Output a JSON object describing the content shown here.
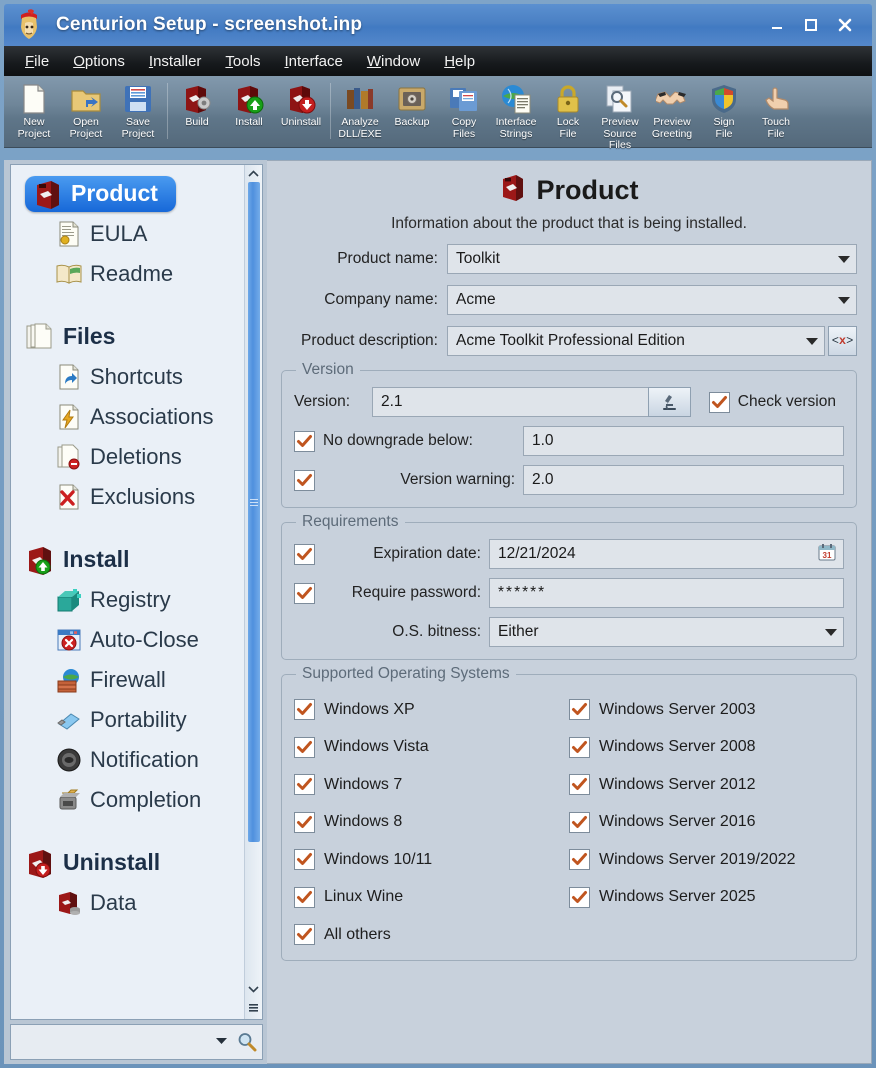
{
  "window": {
    "title": "Centurion Setup - screenshot.inp",
    "app_icon": "centurion-helmet-icon",
    "minimize_label": "_",
    "maximize_label": "□",
    "close_label": "✕"
  },
  "menubar": {
    "items": [
      {
        "name": "file",
        "label": "File",
        "mnemonic": "F"
      },
      {
        "name": "options",
        "label": "Options",
        "mnemonic": "O"
      },
      {
        "name": "installer",
        "label": "Installer",
        "mnemonic": "I"
      },
      {
        "name": "tools",
        "label": "Tools",
        "mnemonic": "T"
      },
      {
        "name": "interface",
        "label": "Interface",
        "mnemonic": "I"
      },
      {
        "name": "window",
        "label": "Window",
        "mnemonic": "W"
      },
      {
        "name": "help",
        "label": "Help",
        "mnemonic": "H"
      }
    ]
  },
  "toolbar": {
    "buttons": [
      {
        "name": "new-project",
        "line1": "New",
        "line2": "Project",
        "icon": "new-document-icon"
      },
      {
        "name": "open-project",
        "line1": "Open",
        "line2": "Project",
        "icon": "open-folder-icon"
      },
      {
        "name": "save-project",
        "line1": "Save",
        "line2": "Project",
        "icon": "floppy-disk-icon"
      },
      {
        "sep": true
      },
      {
        "name": "build",
        "line1": "Build",
        "line2": "",
        "icon": "box-gear-icon"
      },
      {
        "name": "install",
        "line1": "Install",
        "line2": "",
        "icon": "box-green-arrow-up-icon"
      },
      {
        "name": "uninstall",
        "line1": "Uninstall",
        "line2": "",
        "icon": "box-red-arrow-down-icon"
      },
      {
        "sep": true
      },
      {
        "name": "analyze-dll-exe",
        "line1": "Analyze",
        "line2": "DLL/EXE",
        "icon": "books-icon"
      },
      {
        "name": "backup",
        "line1": "Backup",
        "line2": "",
        "icon": "safe-icon"
      },
      {
        "name": "copy-files",
        "line1": "Copy",
        "line2": "Files",
        "icon": "copy-files-icon"
      },
      {
        "name": "interface-strings",
        "line1": "Interface",
        "line2": "Strings",
        "icon": "globe-document-icon"
      },
      {
        "name": "lock-file",
        "line1": "Lock",
        "line2": "File",
        "icon": "padlock-icon"
      },
      {
        "name": "preview-source-files",
        "line1": "Preview",
        "line2": "Source Files",
        "icon": "magnifier-pages-icon"
      },
      {
        "name": "preview-greeting",
        "line1": "Preview",
        "line2": "Greeting",
        "icon": "handshake-icon"
      },
      {
        "name": "sign-file",
        "line1": "Sign",
        "line2": "File",
        "icon": "shield-icon"
      },
      {
        "name": "touch-file",
        "line1": "Touch",
        "line2": "File",
        "icon": "hand-pointer-icon"
      }
    ]
  },
  "sidebar": {
    "nodes": [
      {
        "name": "product",
        "label": "Product",
        "icon": "red-box-icon",
        "level": "root",
        "selected": true
      },
      {
        "name": "eula",
        "label": "EULA",
        "icon": "document-seal-icon",
        "level": "child"
      },
      {
        "name": "readme",
        "label": "Readme",
        "icon": "open-book-icon",
        "level": "child"
      },
      {
        "spacer": true
      },
      {
        "name": "files",
        "label": "Files",
        "icon": "stacked-pages-icon",
        "level": "root"
      },
      {
        "name": "shortcuts",
        "label": "Shortcuts",
        "icon": "shortcut-arrow-icon",
        "level": "child"
      },
      {
        "name": "associations",
        "label": "Associations",
        "icon": "lightning-document-icon",
        "level": "child"
      },
      {
        "name": "deletions",
        "label": "Deletions",
        "icon": "pages-minus-icon",
        "level": "child"
      },
      {
        "name": "exclusions",
        "label": "Exclusions",
        "icon": "red-x-document-icon",
        "level": "child"
      },
      {
        "spacer": true
      },
      {
        "name": "install",
        "label": "Install",
        "icon": "box-green-arrow-up-icon",
        "level": "root"
      },
      {
        "name": "registry",
        "label": "Registry",
        "icon": "registry-blocks-icon",
        "level": "child"
      },
      {
        "name": "auto-close",
        "label": "Auto-Close",
        "icon": "window-red-x-icon",
        "level": "child"
      },
      {
        "name": "firewall",
        "label": "Firewall",
        "icon": "firewall-brick-globe-icon",
        "level": "child"
      },
      {
        "name": "portability",
        "label": "Portability",
        "icon": "usb-stick-icon",
        "level": "child"
      },
      {
        "name": "notification",
        "label": "Notification",
        "icon": "speaker-icon",
        "level": "child"
      },
      {
        "name": "completion",
        "label": "Completion",
        "icon": "toaster-icon",
        "level": "child"
      },
      {
        "spacer": true
      },
      {
        "name": "uninstall",
        "label": "Uninstall",
        "icon": "box-red-arrow-down-icon",
        "level": "root"
      },
      {
        "name": "data",
        "label": "Data",
        "icon": "box-database-icon",
        "level": "child"
      }
    ],
    "search": {
      "value": "",
      "placeholder": "",
      "caret_icon": "chevron-down-icon",
      "search_icon": "magnifier-icon"
    },
    "scrollbar": {
      "up_icon": "chevron-up-icon",
      "down_icon": "chevron-down-icon",
      "menu_icon": "list-icon"
    }
  },
  "main": {
    "title": "Product",
    "title_icon": "red-box-icon",
    "subtitle": "Information about the product that is being installed.",
    "fields": [
      {
        "name": "product-name",
        "label": "Product name:",
        "value": "Toolkit",
        "type": "combo"
      },
      {
        "name": "company-name",
        "label": "Company name:",
        "value": "Acme",
        "type": "combo"
      },
      {
        "name": "product-description",
        "label": "Product description:",
        "value": "Acme Toolkit Professional Edition",
        "type": "combo",
        "extra_button": "<x>"
      }
    ],
    "version_group": {
      "title": "Version",
      "version_label": "Version:",
      "version_value": "2.1",
      "analyze_icon": "microscope-icon",
      "check_version": {
        "label": "Check version",
        "checked": true
      },
      "no_downgrade": {
        "label": "No downgrade below:",
        "checked": true,
        "value": "1.0"
      },
      "version_warning": {
        "label": "Version warning:",
        "checked": true,
        "value": "2.0"
      }
    },
    "requirements_group": {
      "title": "Requirements",
      "expiration": {
        "label": "Expiration date:",
        "checked": true,
        "value": "12/21/2024",
        "icon": "calendar-icon"
      },
      "password": {
        "label": "Require password:",
        "checked": true,
        "value": "******"
      },
      "bitness": {
        "label": "O.S. bitness:",
        "value": "Either"
      }
    },
    "os_group": {
      "title": "Supported Operating Systems",
      "left": [
        {
          "name": "windows-xp",
          "label": "Windows XP",
          "checked": true
        },
        {
          "name": "windows-vista",
          "label": "Windows Vista",
          "checked": true
        },
        {
          "name": "windows-7",
          "label": "Windows 7",
          "checked": true
        },
        {
          "name": "windows-8",
          "label": "Windows 8",
          "checked": true
        },
        {
          "name": "windows-10-11",
          "label": "Windows 10/11",
          "checked": true
        },
        {
          "name": "linux-wine",
          "label": "Linux Wine",
          "checked": true
        },
        {
          "name": "all-others",
          "label": "All others",
          "checked": true
        }
      ],
      "right": [
        {
          "name": "windows-server-2003",
          "label": "Windows Server 2003",
          "checked": true
        },
        {
          "name": "windows-server-2008",
          "label": "Windows Server 2008",
          "checked": true
        },
        {
          "name": "windows-server-2012",
          "label": "Windows Server 2012",
          "checked": true
        },
        {
          "name": "windows-server-2016",
          "label": "Windows Server 2016",
          "checked": true
        },
        {
          "name": "windows-server-2019-2022",
          "label": "Windows Server 2019/2022",
          "checked": true
        },
        {
          "name": "windows-server-2025",
          "label": "Windows Server 2025",
          "checked": true
        }
      ]
    }
  },
  "colors": {
    "titlebar": "#4a80c4",
    "menubar": "#16191c",
    "toolbar": "#6f8699",
    "panel_bg": "#c8d1dc",
    "tree_bg": "#eaf0f7",
    "selection": "#1768d8",
    "checkmark": "#c0551f",
    "scrollbar_thumb": "#4f90de"
  }
}
